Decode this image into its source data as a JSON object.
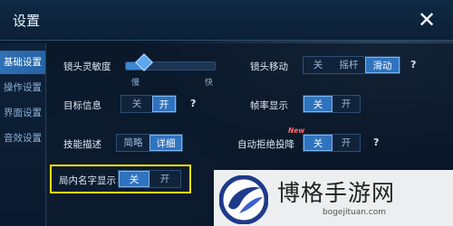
{
  "window": {
    "title": "设置",
    "close_icon": "close-icon"
  },
  "sidebar": {
    "tabs": [
      {
        "label": "基础设置",
        "active": true
      },
      {
        "label": "操作设置",
        "active": false
      },
      {
        "label": "界面设置",
        "active": false
      },
      {
        "label": "音效设置",
        "active": false
      }
    ]
  },
  "settings": {
    "camera_sensitivity": {
      "label": "镜头灵敏度",
      "value_fraction": 0.2,
      "min_label": "慢",
      "max_label": "快"
    },
    "camera_move": {
      "label": "镜头移动",
      "options": [
        "关",
        "摇杆",
        "滑动"
      ],
      "selected": 2,
      "help": "?"
    },
    "target_info": {
      "label": "目标信息",
      "options": [
        "关",
        "开"
      ],
      "selected": 1,
      "help": "?"
    },
    "fps_display": {
      "label": "帧率显示",
      "options": [
        "关",
        "开"
      ],
      "selected": 0
    },
    "skill_desc": {
      "label": "技能描述",
      "options": [
        "简略",
        "详细"
      ],
      "selected": 1
    },
    "auto_reject_surrender": {
      "label": "自动拒绝投降",
      "badge": "New",
      "options": [
        "关",
        "开"
      ],
      "selected": 0,
      "help": "?"
    },
    "in_game_name": {
      "label": "局内名字显示",
      "options": [
        "关",
        "开"
      ],
      "selected": 0
    }
  },
  "watermark": {
    "text": "博格手游网",
    "url": "bogejituan.com"
  },
  "colors": {
    "accent": "#2f73bf",
    "highlight": "#ffe100",
    "badge": "#ff6d6d"
  }
}
